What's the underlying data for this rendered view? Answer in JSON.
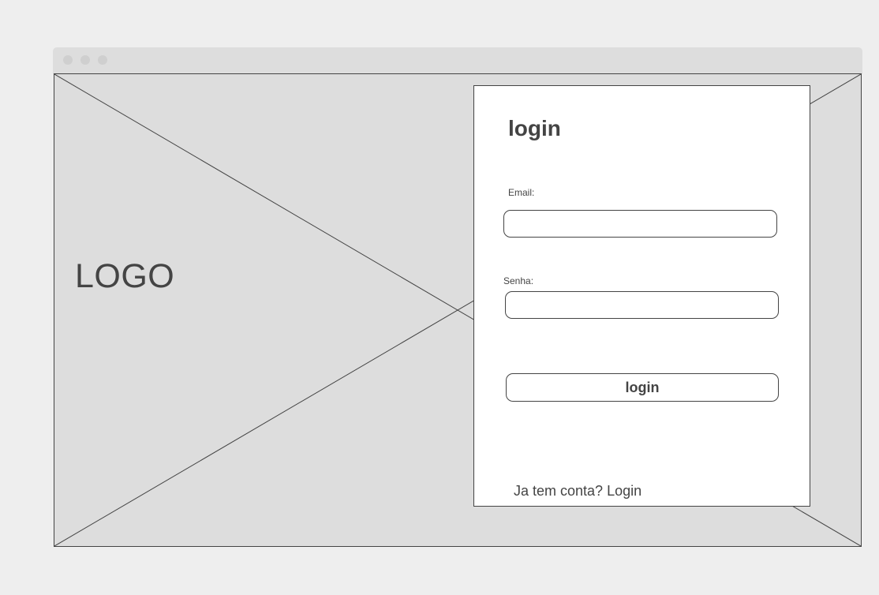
{
  "window": {
    "controls": [
      "window-dot",
      "window-dot",
      "window-dot"
    ]
  },
  "hero": {
    "logo_text": "LOGO"
  },
  "login_card": {
    "title": "login",
    "email_label": "Email:",
    "email_value": "",
    "password_label": "Senha:",
    "password_value": "",
    "submit_label": "login",
    "footer_text": "Ja tem conta? Login"
  },
  "colors": {
    "page_background": "#eeeeee",
    "placeholder_fill": "#dddddd",
    "stroke": "#444444",
    "card_background": "#ffffff"
  }
}
